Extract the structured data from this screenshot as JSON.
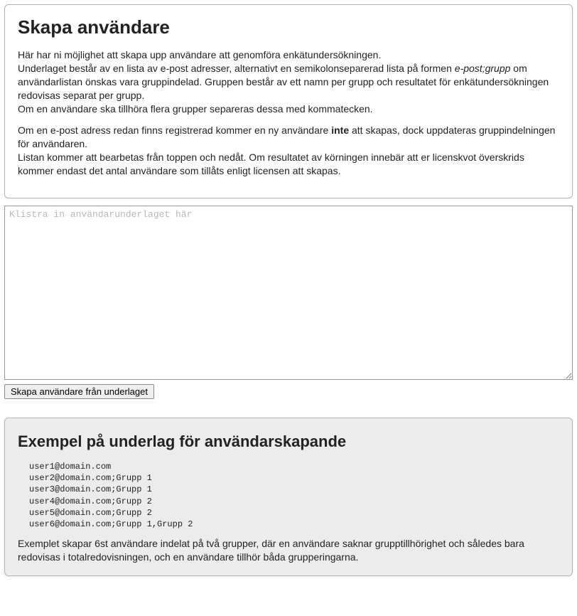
{
  "intro": {
    "heading": "Skapa användare",
    "p1_a": "Här har ni möjlighet att skapa upp användare att genomföra enkätundersökningen.\nUnderlaget består av en lista av e-post adresser, alternativt en semikolonseparerad lista på formen ",
    "p1_em": "e-post;grupp",
    "p1_b": " om användarlistan önskas vara gruppindelad. Gruppen består av ett namn per grupp och resultatet för enkätundersökningen redovisas separat per grupp.\nOm en användare ska tillhöra flera grupper separeras dessa med kommatecken.",
    "p2_a": "Om en e-post adress redan finns registrerad kommer en ny användare ",
    "p2_strong": "inte",
    "p2_b": " att skapas, dock uppdateras gruppindelningen för användaren.\nListan kommer att bearbetas från toppen och nedåt. Om resultatet av körningen innebär att er licenskvot överskrids kommer endast det antal användare som tillåts enligt licensen att skapas."
  },
  "form": {
    "textarea_placeholder": "Klistra in användarunderlaget här",
    "textarea_value": "",
    "submit_label": "Skapa användare från underlaget"
  },
  "example": {
    "heading": "Exempel på underlag för användarskapande",
    "lines": "user1@domain.com\nuser2@domain.com;Grupp 1\nuser3@domain.com;Grupp 1\nuser4@domain.com;Grupp 2\nuser5@domain.com;Grupp 2\nuser6@domain.com;Grupp 1,Grupp 2",
    "description": "Exemplet skapar 6st användare indelat på två grupper, där en användare saknar grupptillhörighet och således bara redovisas i totalredovisningen, och en användare tillhör båda grupperingarna."
  }
}
